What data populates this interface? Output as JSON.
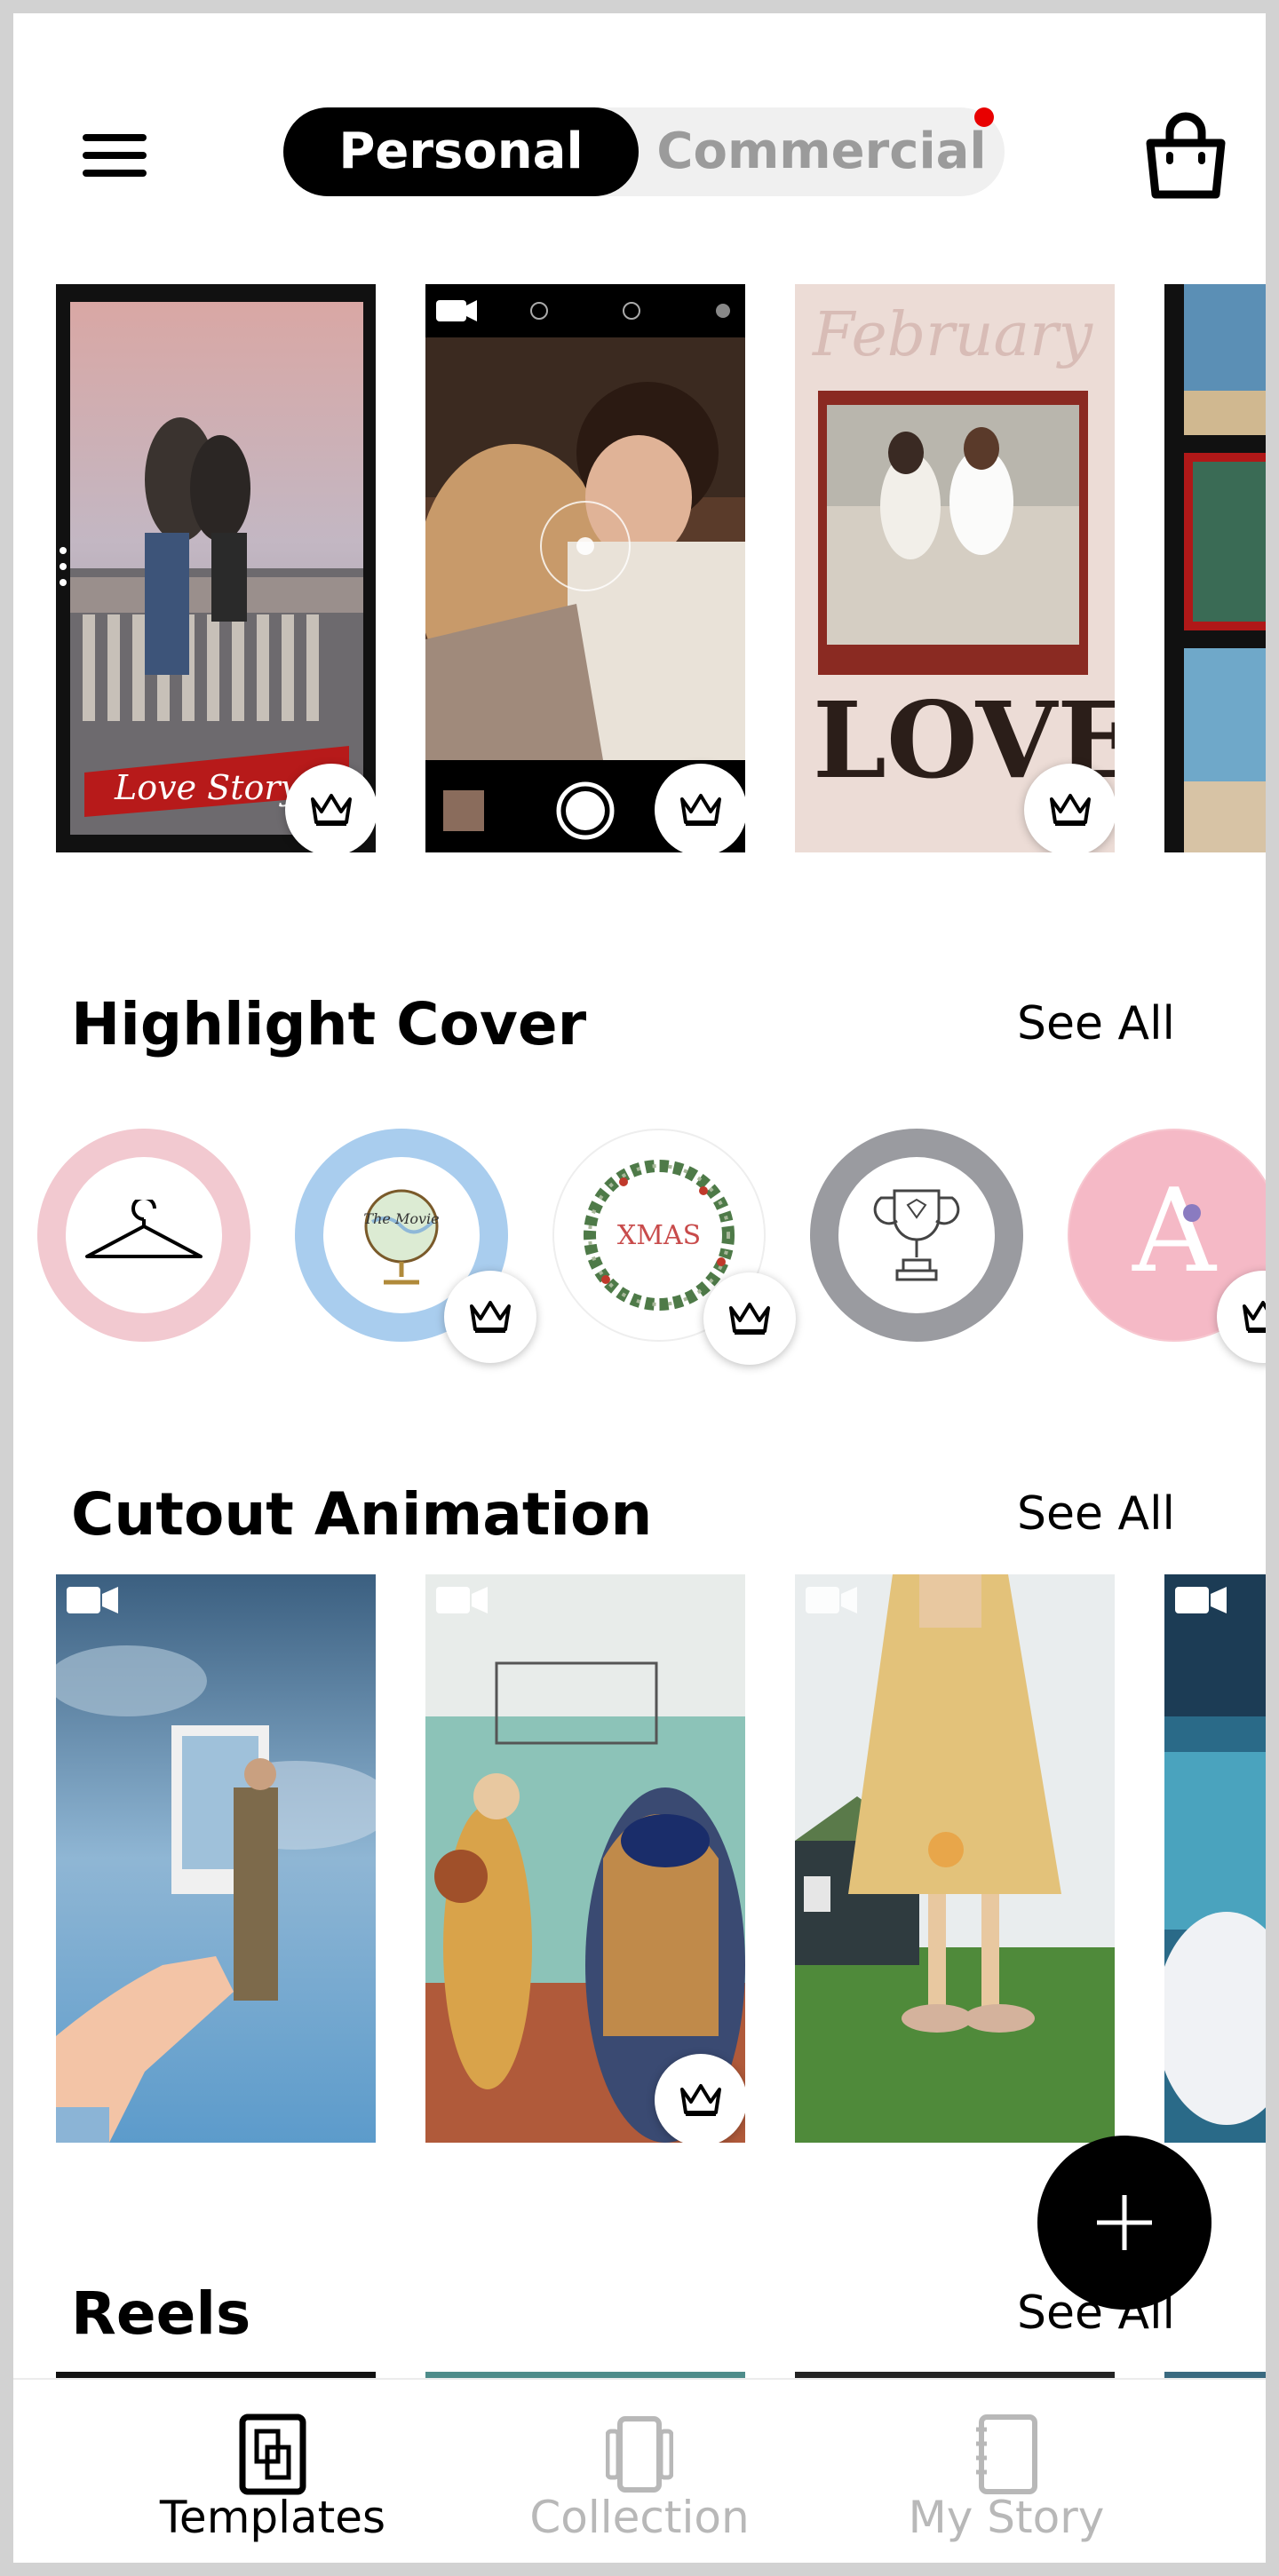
{
  "header": {
    "tabs": [
      "Personal",
      "Commercial"
    ],
    "active_tab": "Personal"
  },
  "featured": {
    "cards": [
      {
        "caption": "Love Story",
        "has_video": false,
        "premium": true
      },
      {
        "caption": "",
        "has_video": true,
        "premium": true
      },
      {
        "caption": "LOVE",
        "top_text": "February",
        "has_video": false,
        "premium": true
      },
      {
        "caption": "",
        "has_video": false,
        "premium": false
      }
    ]
  },
  "highlight": {
    "title": "Highlight Cover",
    "see_all": "See All",
    "items": [
      {
        "icon": "hanger-icon",
        "ring_color": "#f2c9d0",
        "label": "",
        "premium": false
      },
      {
        "icon": "globe-icon",
        "ring_color": "#a9cdee",
        "label": "The Movie",
        "premium": true
      },
      {
        "icon": "wreath-icon",
        "ring_color": "#ffffff",
        "label": "XMAS",
        "premium": true
      },
      {
        "icon": "trophy-icon",
        "ring_color": "#9a9ba0",
        "label": "",
        "premium": false
      },
      {
        "icon": "letter-icon",
        "ring_color": "#f7c7d0",
        "label": "A",
        "premium": true
      }
    ]
  },
  "cutout": {
    "title": "Cutout Animation",
    "see_all": "See All",
    "cards": [
      {
        "has_video": true,
        "premium": false
      },
      {
        "has_video": true,
        "premium": true
      },
      {
        "has_video": true,
        "premium": false
      },
      {
        "has_video": true,
        "premium": false
      }
    ]
  },
  "reels": {
    "title": "Reels",
    "see_all": "See All"
  },
  "bottom_nav": {
    "items": [
      {
        "label": "Templates",
        "active": true
      },
      {
        "label": "Collection",
        "active": false
      },
      {
        "label": "My Story",
        "active": false
      }
    ]
  },
  "colors": {
    "active": "#000000",
    "inactive": "#b8b8b8",
    "notification": "#e80000"
  }
}
